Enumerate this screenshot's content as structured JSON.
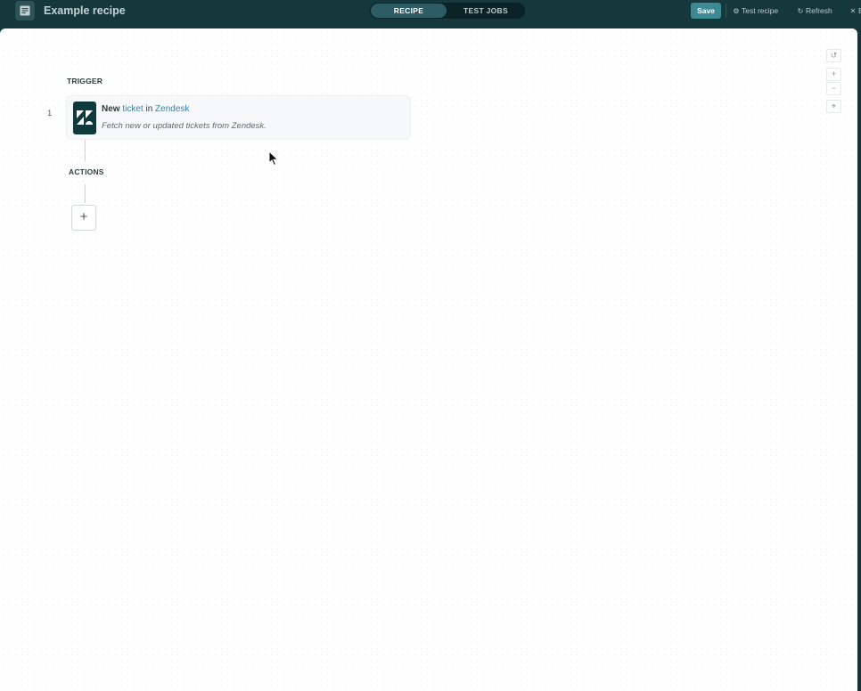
{
  "header": {
    "icon": "recipe-document-icon",
    "title": "Example recipe",
    "tabs": [
      {
        "label": "RECIPE",
        "active": true
      },
      {
        "label": "TEST JOBS",
        "active": false
      }
    ],
    "save_label": "Save",
    "test_recipe_label": "Test recipe",
    "refresh_label": "Refresh",
    "exit_label": "E",
    "colors": {
      "bar": "#15383d",
      "save": "#3d8a95",
      "active_tab": "#2d5c64"
    }
  },
  "canvas": {
    "trigger_label": "TRIGGER",
    "actions_label": "ACTIONS",
    "step": {
      "number": "1",
      "app_icon": "zendesk-logo",
      "title_verb": "New",
      "title_object": "ticket",
      "title_connector": "in",
      "title_app": "Zendesk",
      "description": "Fetch new or updated tickets from Zendesk."
    },
    "add_step_symbol": "+",
    "controls": {
      "reset": "↺",
      "zoom_in": "+",
      "zoom_out": "−",
      "fit": "⌖"
    }
  }
}
